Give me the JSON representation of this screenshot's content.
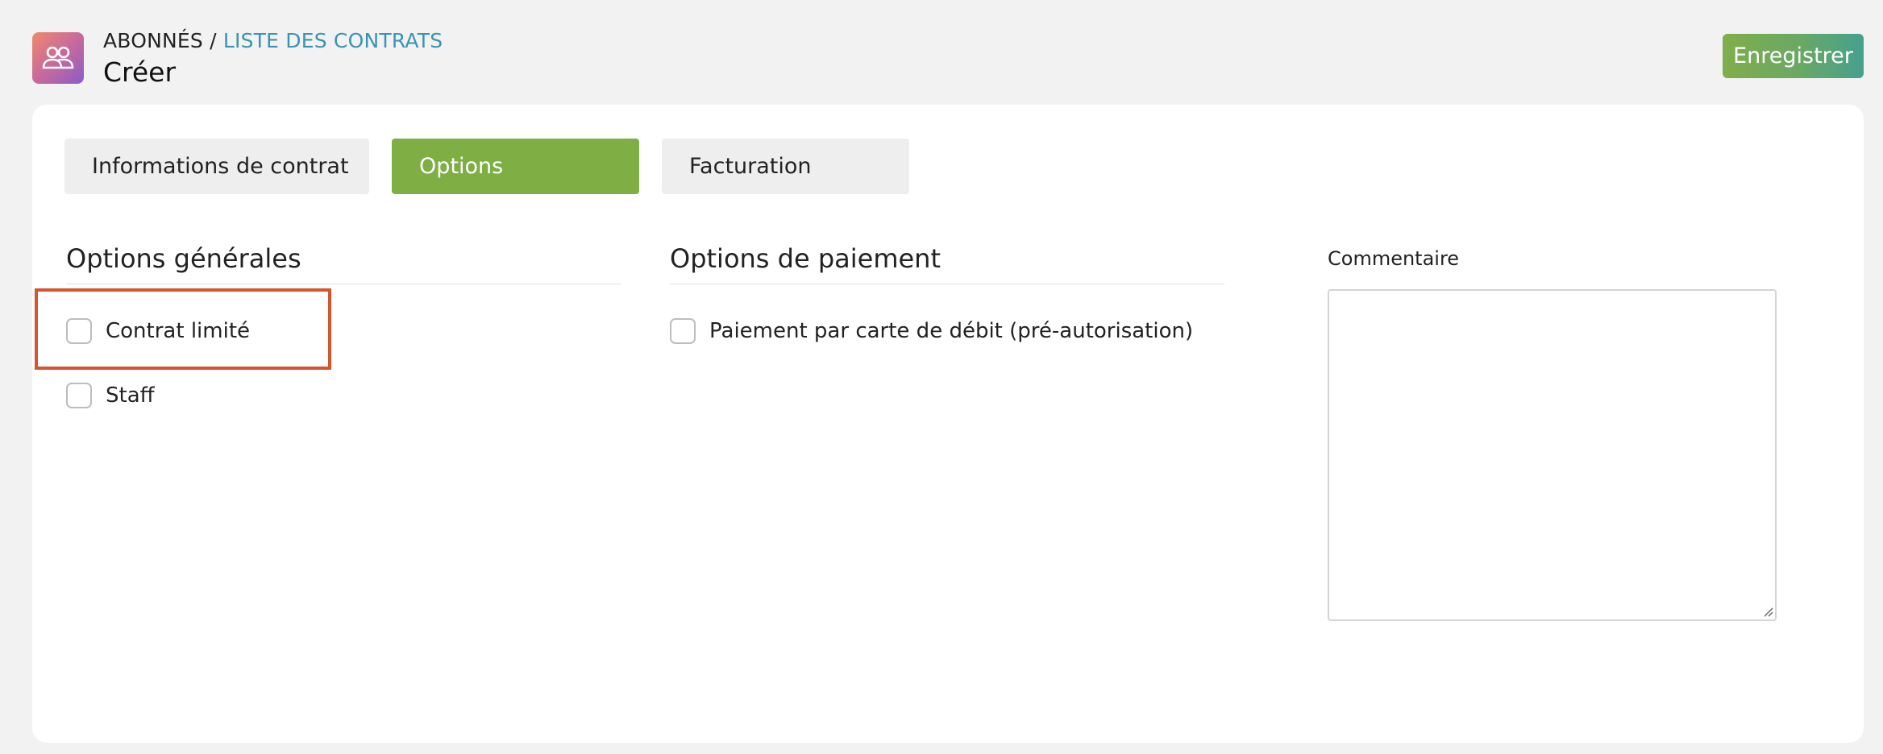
{
  "header": {
    "breadcrumb_root": "ABONNÉS",
    "breadcrumb_sep": " / ",
    "breadcrumb_link": "LISTE DES CONTRATS",
    "title": "Créer",
    "icon": "users-icon",
    "save_label": "Enregistrer"
  },
  "tabs": [
    {
      "label": "Informations de contrat",
      "active": false
    },
    {
      "label": "Options",
      "active": true
    },
    {
      "label": "Facturation",
      "active": false
    }
  ],
  "general_options": {
    "title": "Options générales",
    "items": [
      {
        "label": "Contrat limité",
        "checked": false,
        "highlighted": true
      },
      {
        "label": "Staff",
        "checked": false
      }
    ]
  },
  "payment_options": {
    "title": "Options de paiement",
    "items": [
      {
        "label": "Paiement par carte de débit (pré-autorisation)",
        "checked": false
      }
    ]
  },
  "comment": {
    "label": "Commentaire",
    "value": ""
  },
  "colors": {
    "accent_green": "#7fae44",
    "link_blue": "#3a93b4",
    "highlight_orange": "#d4552e"
  }
}
